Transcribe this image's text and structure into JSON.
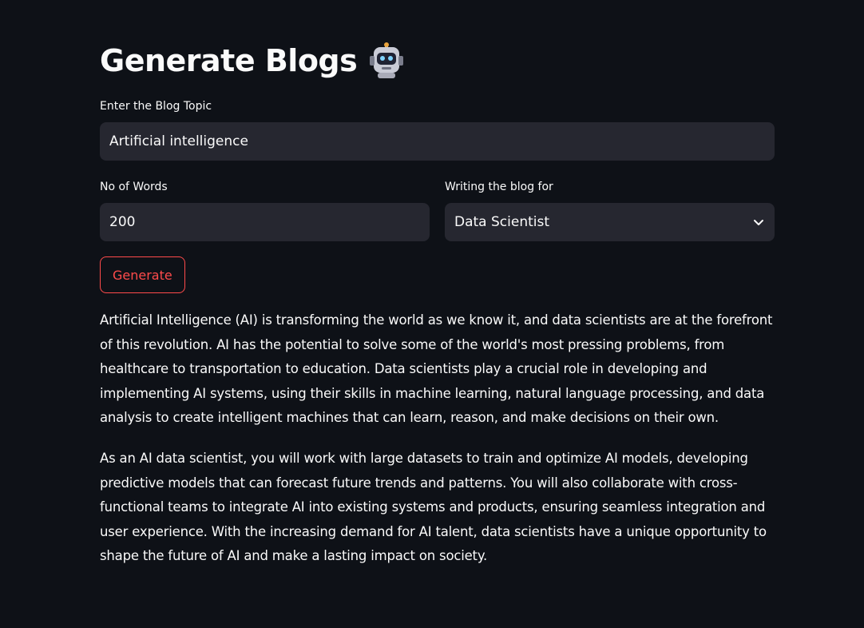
{
  "header": {
    "title": "Generate Blogs"
  },
  "topic": {
    "label": "Enter the Blog Topic",
    "value": "Artificial intelligence"
  },
  "words": {
    "label": "No of Words",
    "value": "200"
  },
  "audience": {
    "label": "Writing the blog for",
    "selected": "Data Scientist"
  },
  "actions": {
    "generate_label": "Generate"
  },
  "output": {
    "paragraphs": [
      "Artificial Intelligence (AI) is transforming the world as we know it, and data scientists are at the forefront of this revolution. AI has the potential to solve some of the world's most pressing problems, from healthcare to transportation to education. Data scientists play a crucial role in developing and implementing AI systems, using their skills in machine learning, natural language processing, and data analysis to create intelligent machines that can learn, reason, and make decisions on their own.",
      "As an AI data scientist, you will work with large datasets to train and optimize AI models, developing predictive models that can forecast future trends and patterns. You will also collaborate with cross-functional teams to integrate AI into existing systems and products, ensuring seamless integration and user experience. With the increasing demand for AI talent, data scientists have a unique opportunity to shape the future of AI and make a lasting impact on society."
    ]
  },
  "colors": {
    "background": "#0e1117",
    "input_background": "#262730",
    "accent": "#ff4b4b",
    "text": "#fafafa"
  },
  "icons": {
    "title_icon": "robot-icon",
    "select_icon": "chevron-down-icon"
  }
}
